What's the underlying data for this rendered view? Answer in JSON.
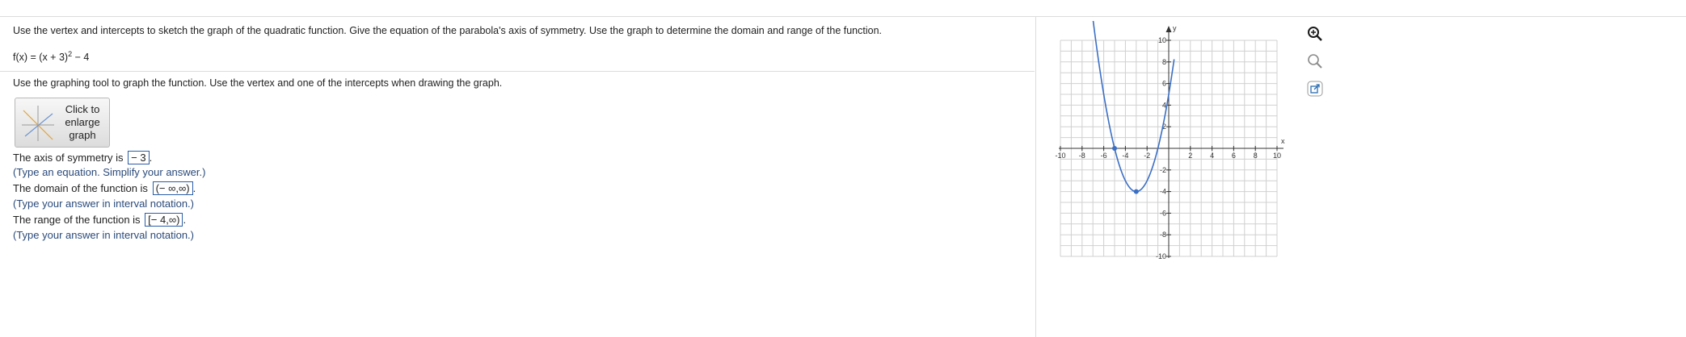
{
  "question": "Use the vertex and intercepts to sketch the graph of the quadratic function.  Give the equation of the parabola's axis of symmetry. Use the graph to determine the domain and range of the function.",
  "function": {
    "prefix": "f(x) = (x + 3)",
    "exponent": "2",
    "suffix": " − 4"
  },
  "instruction": "Use the graphing tool to graph the function.  Use the vertex and one of the intercepts when drawing the graph.",
  "enlarge_button": {
    "line1": "Click to",
    "line2": "enlarge",
    "line3": "graph"
  },
  "answers": {
    "axis_label": "The axis of symmetry is",
    "axis_value": "− 3",
    "axis_hint": "(Type an equation.  Simplify your answer.)",
    "domain_label": "The domain of the function is",
    "domain_value": "(− ∞,∞)",
    "domain_hint": "(Type your answer in interval notation.)",
    "range_label": "The range of the function is",
    "range_value": "[− 4,∞)",
    "range_hint": "(Type your answer in interval notation.)"
  },
  "tools": [
    "zoom-in-icon",
    "zoom-out-icon",
    "popout-icon"
  ],
  "colors": {
    "curve": "#3b6fc4",
    "answer_border": "#2b5da8",
    "grid": "#d0d0d0"
  },
  "chart_data": {
    "type": "line",
    "xlabel": "x",
    "ylabel": "y",
    "xlim": [
      -10,
      10
    ],
    "ylim": [
      -10,
      10
    ],
    "grid": true,
    "x_ticks": [
      "-10",
      "-8",
      "-6",
      "-4",
      "-2",
      "2",
      "4",
      "6",
      "8",
      "10"
    ],
    "y_ticks": [
      "10",
      "8",
      "6",
      "4",
      "2",
      "-2",
      "-4",
      "-6",
      "-8",
      "-10"
    ],
    "series": [
      {
        "equation": "y = (x + 3)^2 - 4",
        "x_range": [
          -7.2,
          0.5
        ]
      }
    ],
    "points": [
      {
        "x": -3,
        "y": -4
      },
      {
        "x": -5,
        "y": 0
      }
    ]
  }
}
